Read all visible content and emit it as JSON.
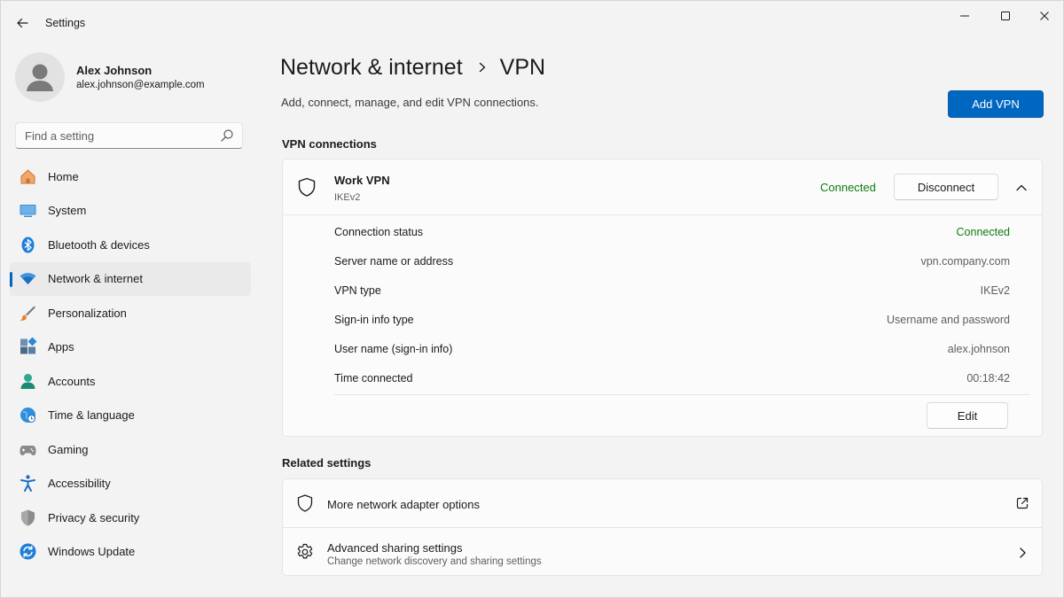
{
  "window": {
    "app_title": "Settings"
  },
  "profile": {
    "name": "Alex Johnson",
    "email": "alex.johnson@example.com"
  },
  "search": {
    "placeholder": "Find a setting"
  },
  "sidebar": {
    "items": [
      {
        "label": "Home",
        "icon": "home-icon",
        "active": false
      },
      {
        "label": "System",
        "icon": "system-icon",
        "active": false
      },
      {
        "label": "Bluetooth & devices",
        "icon": "bluetooth-icon",
        "active": false
      },
      {
        "label": "Network & internet",
        "icon": "wifi-icon",
        "active": true
      },
      {
        "label": "Personalization",
        "icon": "brush-icon",
        "active": false
      },
      {
        "label": "Apps",
        "icon": "apps-icon",
        "active": false
      },
      {
        "label": "Accounts",
        "icon": "accounts-icon",
        "active": false
      },
      {
        "label": "Time & language",
        "icon": "globe-clock-icon",
        "active": false
      },
      {
        "label": "Gaming",
        "icon": "gamepad-icon",
        "active": false
      },
      {
        "label": "Accessibility",
        "icon": "accessibility-icon",
        "active": false
      },
      {
        "label": "Privacy & security",
        "icon": "shield-icon",
        "active": false
      },
      {
        "label": "Windows Update",
        "icon": "update-icon",
        "active": false
      }
    ]
  },
  "header": {
    "breadcrumb_parent": "Network & internet",
    "breadcrumb_current": "VPN",
    "subtitle": "Add, connect, manage, and edit VPN connections.",
    "add_vpn_label": "Add VPN"
  },
  "vpn_section": {
    "title": "VPN connections",
    "connection": {
      "name": "Work VPN",
      "type": "IKEv2",
      "status": "Connected",
      "disconnect_label": "Disconnect",
      "edit_label": "Edit",
      "details": [
        {
          "label": "Connection status",
          "value": "Connected"
        },
        {
          "label": "Server name or address",
          "value": "vpn.company.com"
        },
        {
          "label": "VPN type",
          "value": "IKEv2"
        },
        {
          "label": "Sign-in info type",
          "value": "Username and password"
        },
        {
          "label": "User name (sign-in info)",
          "value": "alex.johnson"
        },
        {
          "label": "Time connected",
          "value": "00:18:42"
        }
      ]
    }
  },
  "related": {
    "title": "Related settings",
    "items": [
      {
        "title": "More network adapter options",
        "description": "",
        "icon": "shield-icon",
        "trail": "external-link-icon"
      },
      {
        "title": "Advanced sharing settings",
        "description": "Change network discovery and sharing settings",
        "icon": "gear-icon",
        "trail": "chevron-right-icon"
      }
    ]
  },
  "colors": {
    "accent": "#0067c0",
    "success": "#0f7b0f"
  }
}
